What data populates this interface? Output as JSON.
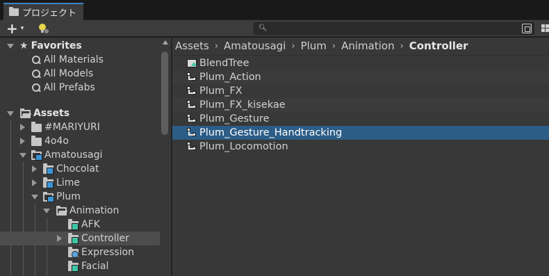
{
  "tab": {
    "label": "プロジェクト"
  },
  "toolbar": {
    "add_label": "+",
    "add_caret": "▾",
    "search_placeholder": "",
    "search_value": ""
  },
  "sidebar": {
    "favorites": {
      "label": "Favorites",
      "items": [
        {
          "label": "All Materials"
        },
        {
          "label": "All Models"
        },
        {
          "label": "All Prefabs"
        }
      ]
    },
    "assets": {
      "label": "Assets",
      "items": [
        {
          "label": "#MARIYURI"
        },
        {
          "label": "4o4o"
        },
        {
          "label": "Amatousagi"
        },
        {
          "label": "Chocolat"
        },
        {
          "label": "Lime"
        },
        {
          "label": "Plum"
        },
        {
          "label": "Animation"
        },
        {
          "label": "AFK"
        },
        {
          "label": "Controller"
        },
        {
          "label": "Expression"
        },
        {
          "label": "Facial"
        }
      ]
    }
  },
  "breadcrumb": {
    "items": [
      "Assets",
      "Amatousagi",
      "Plum",
      "Animation"
    ],
    "current": "Controller",
    "separator": "›"
  },
  "files": [
    {
      "label": "BlendTree",
      "icon": "blendtree-icon"
    },
    {
      "label": "Plum_Action",
      "icon": "animator-controller-icon"
    },
    {
      "label": "Plum_FX",
      "icon": "animator-controller-icon"
    },
    {
      "label": "Plum_FX_kisekae",
      "icon": "animator-controller-icon"
    },
    {
      "label": "Plum_Gesture",
      "icon": "animator-controller-icon"
    },
    {
      "label": "Plum_Gesture_Handtracking",
      "icon": "animator-controller-icon",
      "selected": true
    },
    {
      "label": "Plum_Locomotion",
      "icon": "animator-controller-icon"
    }
  ],
  "colors": {
    "selection": "#2c5d87",
    "panel": "#383838",
    "tab_accent": "#3b82c6"
  }
}
